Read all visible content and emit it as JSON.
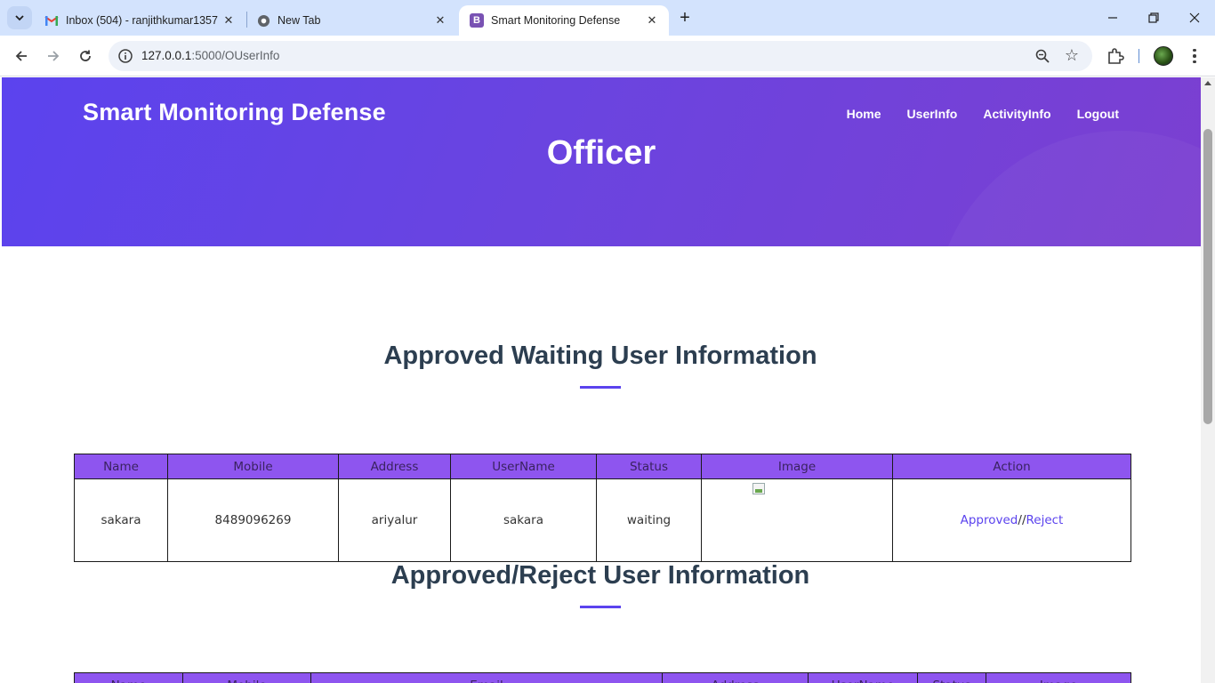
{
  "browser": {
    "tabs": [
      {
        "title": "Inbox (504) - ranjithkumar1357",
        "favicon": "gmail-icon",
        "active": false
      },
      {
        "title": "New Tab",
        "favicon": "chrome-icon",
        "active": false
      },
      {
        "title": "Smart Monitoring Defense",
        "favicon": "bootstrap-icon",
        "active": true
      }
    ],
    "url_host": "127.0.0.1",
    "url_path": ":5000/OUserInfo",
    "favicon_letter": "B"
  },
  "header": {
    "brand": "Smart Monitoring Defense",
    "nav": [
      "Home",
      "UserInfo",
      "ActivityInfo",
      "Logout"
    ],
    "page_title": "Officer"
  },
  "waiting_section": {
    "title": "Approved Waiting User Information",
    "columns": [
      "Name",
      "Mobile",
      "Address",
      "UserName",
      "Status",
      "Image",
      "Action"
    ],
    "rows": [
      {
        "name": "sakara",
        "mobile": "8489096269",
        "address": "ariyalur",
        "username": "sakara",
        "status": "waiting",
        "approve_label": "Approved",
        "separator": "//",
        "reject_label": "Reject"
      }
    ]
  },
  "approved_section": {
    "title": "Approved/Reject User Information",
    "columns": [
      "Name",
      "Mobile",
      "Email",
      "Address",
      "UserName",
      "Status",
      "Image"
    ]
  },
  "colors": {
    "hero_gradient_start": "#5b43ee",
    "hero_gradient_end": "#7b3fd1",
    "table_header": "#8e55ef",
    "heading": "#2c3e50",
    "link": "#5b43ee"
  }
}
